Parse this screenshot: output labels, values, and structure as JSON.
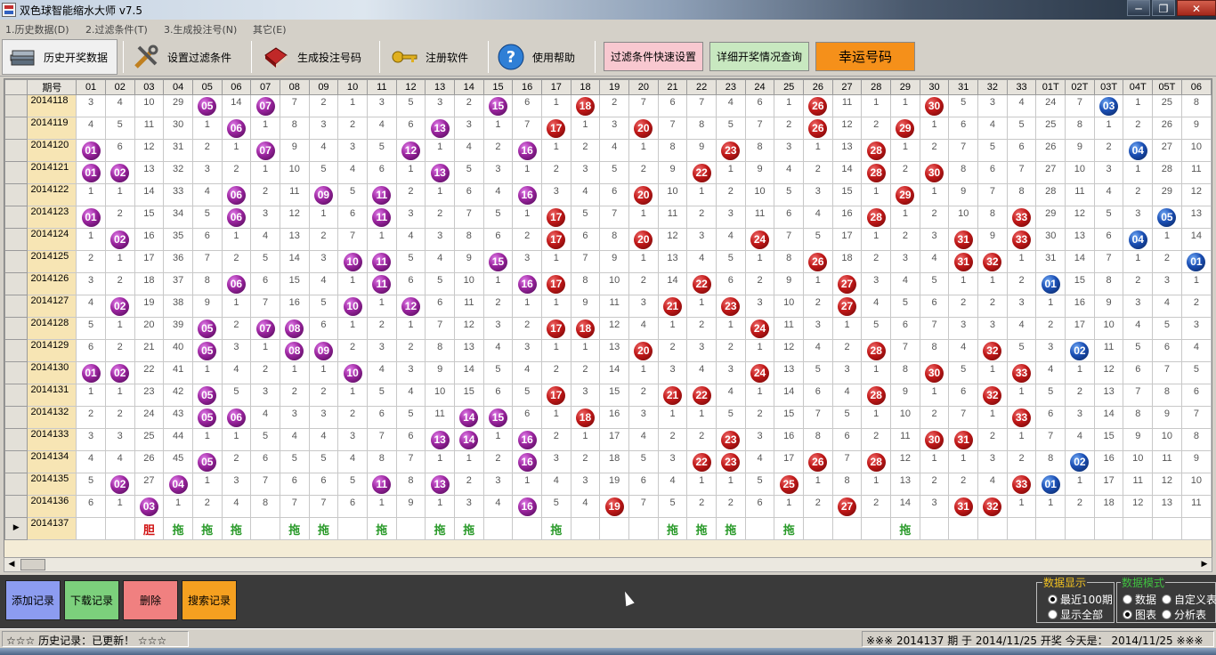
{
  "window": {
    "title": "双色球智能缩水大师 v7.5",
    "minimize": "─",
    "restore": "❐",
    "close": "✕"
  },
  "menu": [
    "1.历史数据(D)",
    "2.过滤条件(T)",
    "3.生成投注号(N)",
    "其它(E)"
  ],
  "toolbar": {
    "history": "历史开奖数据",
    "filters": "设置过滤条件",
    "generate": "生成投注号码",
    "register": "注册软件",
    "help": "使用帮助",
    "quick_filter": "过滤条件快速设置",
    "detail_query": "详细开奖情况查询",
    "lucky": "幸运号码"
  },
  "grid": {
    "period_header": "期号",
    "columns": [
      "01",
      "02",
      "03",
      "04",
      "05",
      "06",
      "07",
      "08",
      "09",
      "10",
      "11",
      "12",
      "13",
      "14",
      "15",
      "16",
      "17",
      "18",
      "19",
      "20",
      "21",
      "22",
      "23",
      "24",
      "25",
      "26",
      "27",
      "28",
      "29",
      "30",
      "31",
      "32",
      "33",
      "01T",
      "02T",
      "03T",
      "04T",
      "05T",
      "06"
    ],
    "rows": [
      {
        "period": "2014118",
        "cells": [
          "3",
          "4",
          "10",
          "29",
          "b05",
          "14",
          "b07",
          "7",
          "2",
          "1",
          "3",
          "5",
          "3",
          "2",
          "b15",
          "6",
          "1",
          "b18",
          "2",
          "7",
          "6",
          "7",
          "4",
          "6",
          "1",
          "b26",
          "11",
          "1",
          "1",
          "b30",
          "5",
          "3",
          "4",
          "24",
          "7",
          "b03",
          "1",
          "25",
          "8"
        ]
      },
      {
        "period": "2014119",
        "cells": [
          "4",
          "5",
          "11",
          "30",
          "1",
          "b06",
          "1",
          "8",
          "3",
          "2",
          "4",
          "6",
          "b13",
          "3",
          "1",
          "7",
          "b17",
          "1",
          "3",
          "b20",
          "7",
          "8",
          "5",
          "7",
          "2",
          "b26",
          "12",
          "2",
          "b29",
          "1",
          "6",
          "4",
          "5",
          "25",
          "8",
          "1",
          "2",
          "26",
          "9"
        ]
      },
      {
        "period": "2014120",
        "cells": [
          "b01",
          "6",
          "12",
          "31",
          "2",
          "1",
          "b07",
          "9",
          "4",
          "3",
          "5",
          "b12",
          "1",
          "4",
          "2",
          "b16",
          "1",
          "2",
          "4",
          "1",
          "8",
          "9",
          "b23",
          "8",
          "3",
          "1",
          "13",
          "b28",
          "1",
          "2",
          "7",
          "5",
          "6",
          "26",
          "9",
          "2",
          "b04",
          "27",
          "10"
        ]
      },
      {
        "period": "2014121",
        "cells": [
          "b01",
          "b02",
          "13",
          "32",
          "3",
          "2",
          "1",
          "10",
          "5",
          "4",
          "6",
          "1",
          "b13",
          "5",
          "3",
          "1",
          "2",
          "3",
          "5",
          "2",
          "9",
          "b22",
          "1",
          "9",
          "4",
          "2",
          "14",
          "b28",
          "2",
          "b30",
          "8",
          "6",
          "7",
          "27",
          "10",
          "3",
          "1",
          "28",
          "11"
        ]
      },
      {
        "period": "2014122",
        "cells": [
          "1",
          "1",
          "14",
          "33",
          "4",
          "b06",
          "2",
          "11",
          "b09",
          "5",
          "b11",
          "2",
          "1",
          "6",
          "4",
          "b16",
          "3",
          "4",
          "6",
          "b20",
          "10",
          "1",
          "2",
          "10",
          "5",
          "3",
          "15",
          "1",
          "b29",
          "1",
          "9",
          "7",
          "8",
          "28",
          "11",
          "4",
          "2",
          "29",
          "12"
        ]
      },
      {
        "period": "2014123",
        "cells": [
          "b01",
          "2",
          "15",
          "34",
          "5",
          "b06",
          "3",
          "12",
          "1",
          "6",
          "b11",
          "3",
          "2",
          "7",
          "5",
          "1",
          "b17",
          "5",
          "7",
          "1",
          "11",
          "2",
          "3",
          "11",
          "6",
          "4",
          "16",
          "b28",
          "1",
          "2",
          "10",
          "8",
          "b33",
          "29",
          "12",
          "5",
          "3",
          "b05",
          "13"
        ]
      },
      {
        "period": "2014124",
        "cells": [
          "1",
          "b02",
          "16",
          "35",
          "6",
          "1",
          "4",
          "13",
          "2",
          "7",
          "1",
          "4",
          "3",
          "8",
          "6",
          "2",
          "b17",
          "6",
          "8",
          "b20",
          "12",
          "3",
          "4",
          "b24",
          "7",
          "5",
          "17",
          "1",
          "2",
          "3",
          "b31",
          "9",
          "b33",
          "30",
          "13",
          "6",
          "b04",
          "1",
          "14"
        ]
      },
      {
        "period": "2014125",
        "cells": [
          "2",
          "1",
          "17",
          "36",
          "7",
          "2",
          "5",
          "14",
          "3",
          "b10",
          "b11",
          "5",
          "4",
          "9",
          "b15",
          "3",
          "1",
          "7",
          "9",
          "1",
          "13",
          "4",
          "5",
          "1",
          "8",
          "b26",
          "18",
          "2",
          "3",
          "4",
          "b31",
          "b32",
          "1",
          "31",
          "14",
          "7",
          "1",
          "2",
          "b01"
        ]
      },
      {
        "period": "2014126",
        "cells": [
          "3",
          "2",
          "18",
          "37",
          "8",
          "b06",
          "6",
          "15",
          "4",
          "1",
          "b11",
          "6",
          "5",
          "10",
          "1",
          "b16",
          "b17",
          "8",
          "10",
          "2",
          "14",
          "b22",
          "6",
          "2",
          "9",
          "1",
          "b27",
          "3",
          "4",
          "5",
          "1",
          "1",
          "2",
          "b01",
          "15",
          "8",
          "2",
          "3",
          "1"
        ]
      },
      {
        "period": "2014127",
        "cells": [
          "4",
          "b02",
          "19",
          "38",
          "9",
          "1",
          "7",
          "16",
          "5",
          "b10",
          "1",
          "b12",
          "6",
          "11",
          "2",
          "1",
          "1",
          "9",
          "11",
          "3",
          "b21",
          "1",
          "b23",
          "3",
          "10",
          "2",
          "b27",
          "4",
          "5",
          "6",
          "2",
          "2",
          "3",
          "1",
          "16",
          "9",
          "3",
          "4",
          "2"
        ]
      },
      {
        "period": "2014128",
        "cells": [
          "5",
          "1",
          "20",
          "39",
          "b05",
          "2",
          "b07",
          "b08",
          "6",
          "1",
          "2",
          "1",
          "7",
          "12",
          "3",
          "2",
          "b17",
          "b18",
          "12",
          "4",
          "1",
          "2",
          "1",
          "b24",
          "11",
          "3",
          "1",
          "5",
          "6",
          "7",
          "3",
          "3",
          "4",
          "2",
          "17",
          "10",
          "4",
          "5",
          "3"
        ]
      },
      {
        "period": "2014129",
        "cells": [
          "6",
          "2",
          "21",
          "40",
          "b05",
          "3",
          "1",
          "b08",
          "b09",
          "2",
          "3",
          "2",
          "8",
          "13",
          "4",
          "3",
          "1",
          "1",
          "13",
          "b20",
          "2",
          "3",
          "2",
          "1",
          "12",
          "4",
          "2",
          "b28",
          "7",
          "8",
          "4",
          "b32",
          "5",
          "3",
          "b02",
          "11",
          "5",
          "6",
          "4"
        ]
      },
      {
        "period": "2014130",
        "cells": [
          "b01",
          "b02",
          "22",
          "41",
          "1",
          "4",
          "2",
          "1",
          "1",
          "b10",
          "4",
          "3",
          "9",
          "14",
          "5",
          "4",
          "2",
          "2",
          "14",
          "1",
          "3",
          "4",
          "3",
          "b24",
          "13",
          "5",
          "3",
          "1",
          "8",
          "b30",
          "5",
          "1",
          "b33",
          "4",
          "1",
          "12",
          "6",
          "7",
          "5"
        ]
      },
      {
        "period": "2014131",
        "cells": [
          "1",
          "1",
          "23",
          "42",
          "b05",
          "5",
          "3",
          "2",
          "2",
          "1",
          "5",
          "4",
          "10",
          "15",
          "6",
          "5",
          "b17",
          "3",
          "15",
          "2",
          "b21",
          "b22",
          "4",
          "1",
          "14",
          "6",
          "4",
          "b28",
          "9",
          "1",
          "6",
          "b32",
          "1",
          "5",
          "2",
          "13",
          "7",
          "8",
          "6"
        ]
      },
      {
        "period": "2014132",
        "cells": [
          "2",
          "2",
          "24",
          "43",
          "b05",
          "b06",
          "4",
          "3",
          "3",
          "2",
          "6",
          "5",
          "11",
          "b14",
          "b15",
          "6",
          "1",
          "b18",
          "16",
          "3",
          "1",
          "1",
          "5",
          "2",
          "15",
          "7",
          "5",
          "1",
          "10",
          "2",
          "7",
          "1",
          "b33",
          "6",
          "3",
          "14",
          "8",
          "9",
          "7"
        ]
      },
      {
        "period": "2014133",
        "cells": [
          "3",
          "3",
          "25",
          "44",
          "1",
          "1",
          "5",
          "4",
          "4",
          "3",
          "7",
          "6",
          "b13",
          "b14",
          "1",
          "b16",
          "2",
          "1",
          "17",
          "4",
          "2",
          "2",
          "b23",
          "3",
          "16",
          "8",
          "6",
          "2",
          "11",
          "b30",
          "b31",
          "2",
          "1",
          "7",
          "4",
          "15",
          "9",
          "10",
          "8"
        ]
      },
      {
        "period": "2014134",
        "cells": [
          "4",
          "4",
          "26",
          "45",
          "b05",
          "2",
          "6",
          "5",
          "5",
          "4",
          "8",
          "7",
          "1",
          "1",
          "2",
          "b16",
          "3",
          "2",
          "18",
          "5",
          "3",
          "b22",
          "b23",
          "4",
          "17",
          "b26",
          "7",
          "b28",
          "12",
          "1",
          "1",
          "3",
          "2",
          "8",
          "b02",
          "16",
          "10",
          "11",
          "9"
        ]
      },
      {
        "period": "2014135",
        "cells": [
          "5",
          "b02",
          "27",
          "b04",
          "1",
          "3",
          "7",
          "6",
          "6",
          "5",
          "b11",
          "8",
          "b13",
          "2",
          "3",
          "1",
          "4",
          "3",
          "19",
          "6",
          "4",
          "1",
          "1",
          "5",
          "b25",
          "1",
          "8",
          "1",
          "13",
          "2",
          "2",
          "4",
          "b33",
          "b01",
          "1",
          "17",
          "11",
          "12",
          "10"
        ]
      },
      {
        "period": "2014136",
        "cells": [
          "6",
          "1",
          "b03",
          "1",
          "2",
          "4",
          "8",
          "7",
          "7",
          "6",
          "1",
          "9",
          "1",
          "3",
          "4",
          "b16",
          "5",
          "4",
          "b19",
          "7",
          "5",
          "2",
          "2",
          "6",
          "1",
          "2",
          "b27",
          "2",
          "14",
          "3",
          "b31",
          "b32",
          "1",
          "1",
          "2",
          "18",
          "12",
          "13",
          "11"
        ]
      }
    ],
    "last_row": {
      "period": "2014137",
      "cells": [
        "",
        "",
        "胆",
        "拖",
        "拖",
        "拖",
        "",
        "拖",
        "拖",
        "",
        "拖",
        "",
        "拖",
        "拖",
        "",
        "",
        "拖",
        "",
        "",
        "",
        "拖",
        "拖",
        "拖",
        "",
        "拖",
        "",
        "",
        "",
        "拖",
        "",
        "",
        "",
        "",
        "",
        "",
        "",
        "",
        "",
        ""
      ]
    }
  },
  "bottom": {
    "add": "添加记录",
    "download": "下载记录",
    "delete": "删除",
    "search": "搜索记录",
    "display_group": "数据显示",
    "recent100": "最近100期",
    "show_all": "显示全部",
    "mode_group": "数据模式",
    "mode_data": "数据",
    "mode_custom": "自定义表",
    "mode_chart": "图表",
    "mode_analysis": "分析表"
  },
  "status": {
    "left": "☆☆☆  历史记录：已更新！  ☆☆☆",
    "right": "※※※  2014137 期 于 2014/11/25 开奖     今天是：  2014/11/25  ※※※"
  },
  "colors": {
    "red_ball": "#c01818",
    "purple_ball": "#9a249e",
    "blue_ball": "#1b4fb4",
    "period_bg": "#f7e5b4",
    "dan": "#d01010",
    "tuo": "#2a9a2a"
  }
}
